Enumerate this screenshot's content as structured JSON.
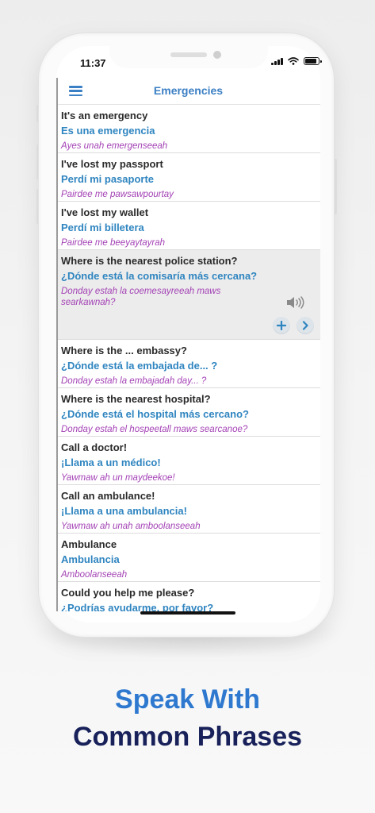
{
  "status_bar": {
    "time": "11:37"
  },
  "header": {
    "title": "Emergencies",
    "menu_icon": "hamburger-menu-icon"
  },
  "phrases": [
    {
      "english": "It's an emergency",
      "spanish": "Es una emergencia",
      "pronunciation": "Ayes unah emergenseeah"
    },
    {
      "english": "I've lost my passport",
      "spanish": "Perdí mi pasaporte",
      "pronunciation": "Pairdee me pawsawpourtay"
    },
    {
      "english": "I've lost my wallet",
      "spanish": "Perdí mi billetera",
      "pronunciation": "Pairdee me beeyaytayrah"
    },
    {
      "english": "Where is the nearest police station?",
      "spanish": "¿Dónde está la comisaría más cercana?",
      "pronunciation": "Donday estah la coemesayreeah maws searkawnah?",
      "expanded": true
    },
    {
      "english": "Where is the ... embassy?",
      "spanish": "¿Dónde está la embajada de... ?",
      "pronunciation": "Donday estah la embajadah day... ?"
    },
    {
      "english": "Where is the nearest hospital?",
      "spanish": "¿Dónde está el hospital más cercano?",
      "pronunciation": "Donday estah el hospeetall maws searcanoe?"
    },
    {
      "english": "Call a doctor!",
      "spanish": "¡Llama a un médico!",
      "pronunciation": "Yawmaw ah un maydeekoe!"
    },
    {
      "english": "Call an ambulance!",
      "spanish": "¡Llama a una ambulancia!",
      "pronunciation": "Yawmaw ah unah amboolanseeah"
    },
    {
      "english": "Ambulance",
      "spanish": "Ambulancia",
      "pronunciation": "Amboolanseeah"
    },
    {
      "english": "Could you help me please?",
      "spanish": "¿Podrías ayudarme, por favor?",
      "pronunciation": ""
    }
  ],
  "row_icons": {
    "audio": "speaker-icon",
    "add": "plus-icon",
    "next": "chevron-right-icon"
  },
  "colors": {
    "accent": "#3b7fc4",
    "spanish": "#2f85c0",
    "pronunciation": "#a341b5",
    "headline_blue": "#2e79cf",
    "headline_dark": "#18215a"
  },
  "promo": {
    "line1": "Speak With",
    "line2": "Common Phrases"
  }
}
